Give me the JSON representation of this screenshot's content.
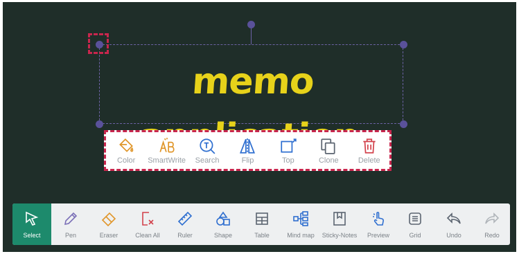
{
  "canvas": {
    "memo_text": "memo application"
  },
  "floating_toolbar": {
    "items": [
      {
        "label": "Color",
        "icon": "fill-bucket-icon",
        "color": "#e0962a"
      },
      {
        "label": "SmartWrite",
        "icon": "smart-write-icon",
        "color": "#e0962a"
      },
      {
        "label": "Search",
        "icon": "text-search-icon",
        "color": "#2f6fd0"
      },
      {
        "label": "Flip",
        "icon": "flip-icon",
        "color": "#2f6fd0"
      },
      {
        "label": "Top",
        "icon": "bring-to-top-icon",
        "color": "#2f6fd0"
      },
      {
        "label": "Clone",
        "icon": "clone-icon",
        "color": "#5b6470"
      },
      {
        "label": "Delete",
        "icon": "trash-icon",
        "color": "#d2414b"
      }
    ]
  },
  "bottom_toolbar": {
    "items": [
      {
        "label": "Select",
        "icon": "cursor-icon",
        "active": true
      },
      {
        "label": "Pen",
        "icon": "pen-icon"
      },
      {
        "label": "Eraser",
        "icon": "eraser-icon"
      },
      {
        "label": "Clean All",
        "icon": "clean-all-icon"
      },
      {
        "label": "Ruler",
        "icon": "ruler-icon"
      },
      {
        "label": "Shape",
        "icon": "shape-icon"
      },
      {
        "label": "Table",
        "icon": "table-icon"
      },
      {
        "label": "Mind map",
        "icon": "mind-map-icon"
      },
      {
        "label": "Sticky-Notes",
        "icon": "sticky-notes-icon"
      },
      {
        "label": "Preview",
        "icon": "preview-icon"
      },
      {
        "label": "Grid",
        "icon": "grid-icon"
      },
      {
        "label": "Undo",
        "icon": "undo-icon"
      },
      {
        "label": "Redo",
        "icon": "redo-icon"
      }
    ]
  },
  "colors": {
    "board": "#1f2e29",
    "accent": "#1d8a6c",
    "highlight": "#c8264d",
    "memo_text": "#e7d21a",
    "selection": "#5a519a"
  }
}
